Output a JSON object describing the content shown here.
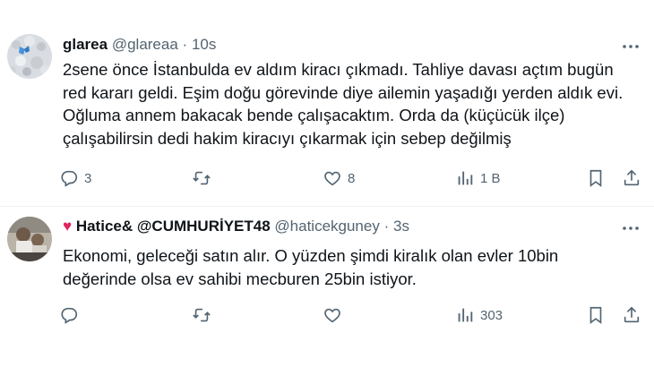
{
  "tweets": [
    {
      "name": "glarea",
      "handle": "@glareaa",
      "separator": "·",
      "time": "10s",
      "lines": [
        "2sene önce İstanbulda ev aldım kiracı çıkmadı. Tahliye davası açtım bugün",
        "red kararı geldi. Eşim doğu görevinde diye ailemin yaşadığı yerden aldık evi.",
        "Oğluma annem bakacak bende çalışacaktım. Orda da (küçücük ilçe)",
        "çalışabilirsin dedi hakim kiracıyı çıkarmak için sebep değilmiş"
      ],
      "replies": "3",
      "retweets": "",
      "likes": "8",
      "views": "1 B"
    },
    {
      "name_prefix": "♥",
      "name": "Hatice& @CUMHURİYET48",
      "handle": "@haticekguney",
      "separator": "·",
      "time": "3s",
      "lines": [
        "Ekonomi, geleceği satın alır. O yüzden şimdi kiralık olan evler 10bin",
        "değerinde olsa ev sahibi mecburen 25bin istiyor."
      ],
      "replies": "",
      "retweets": "",
      "likes": "",
      "views": "303"
    }
  ],
  "icons": {
    "reply": "reply-icon",
    "retweet": "retweet-icon",
    "like": "heart-icon",
    "views": "views-icon",
    "bookmark": "bookmark-icon",
    "share": "share-icon",
    "more": "more-icon"
  },
  "colors": {
    "text": "#0f1419",
    "secondary": "#536471",
    "heart": "#e0245e",
    "divider": "#eff3f4"
  }
}
